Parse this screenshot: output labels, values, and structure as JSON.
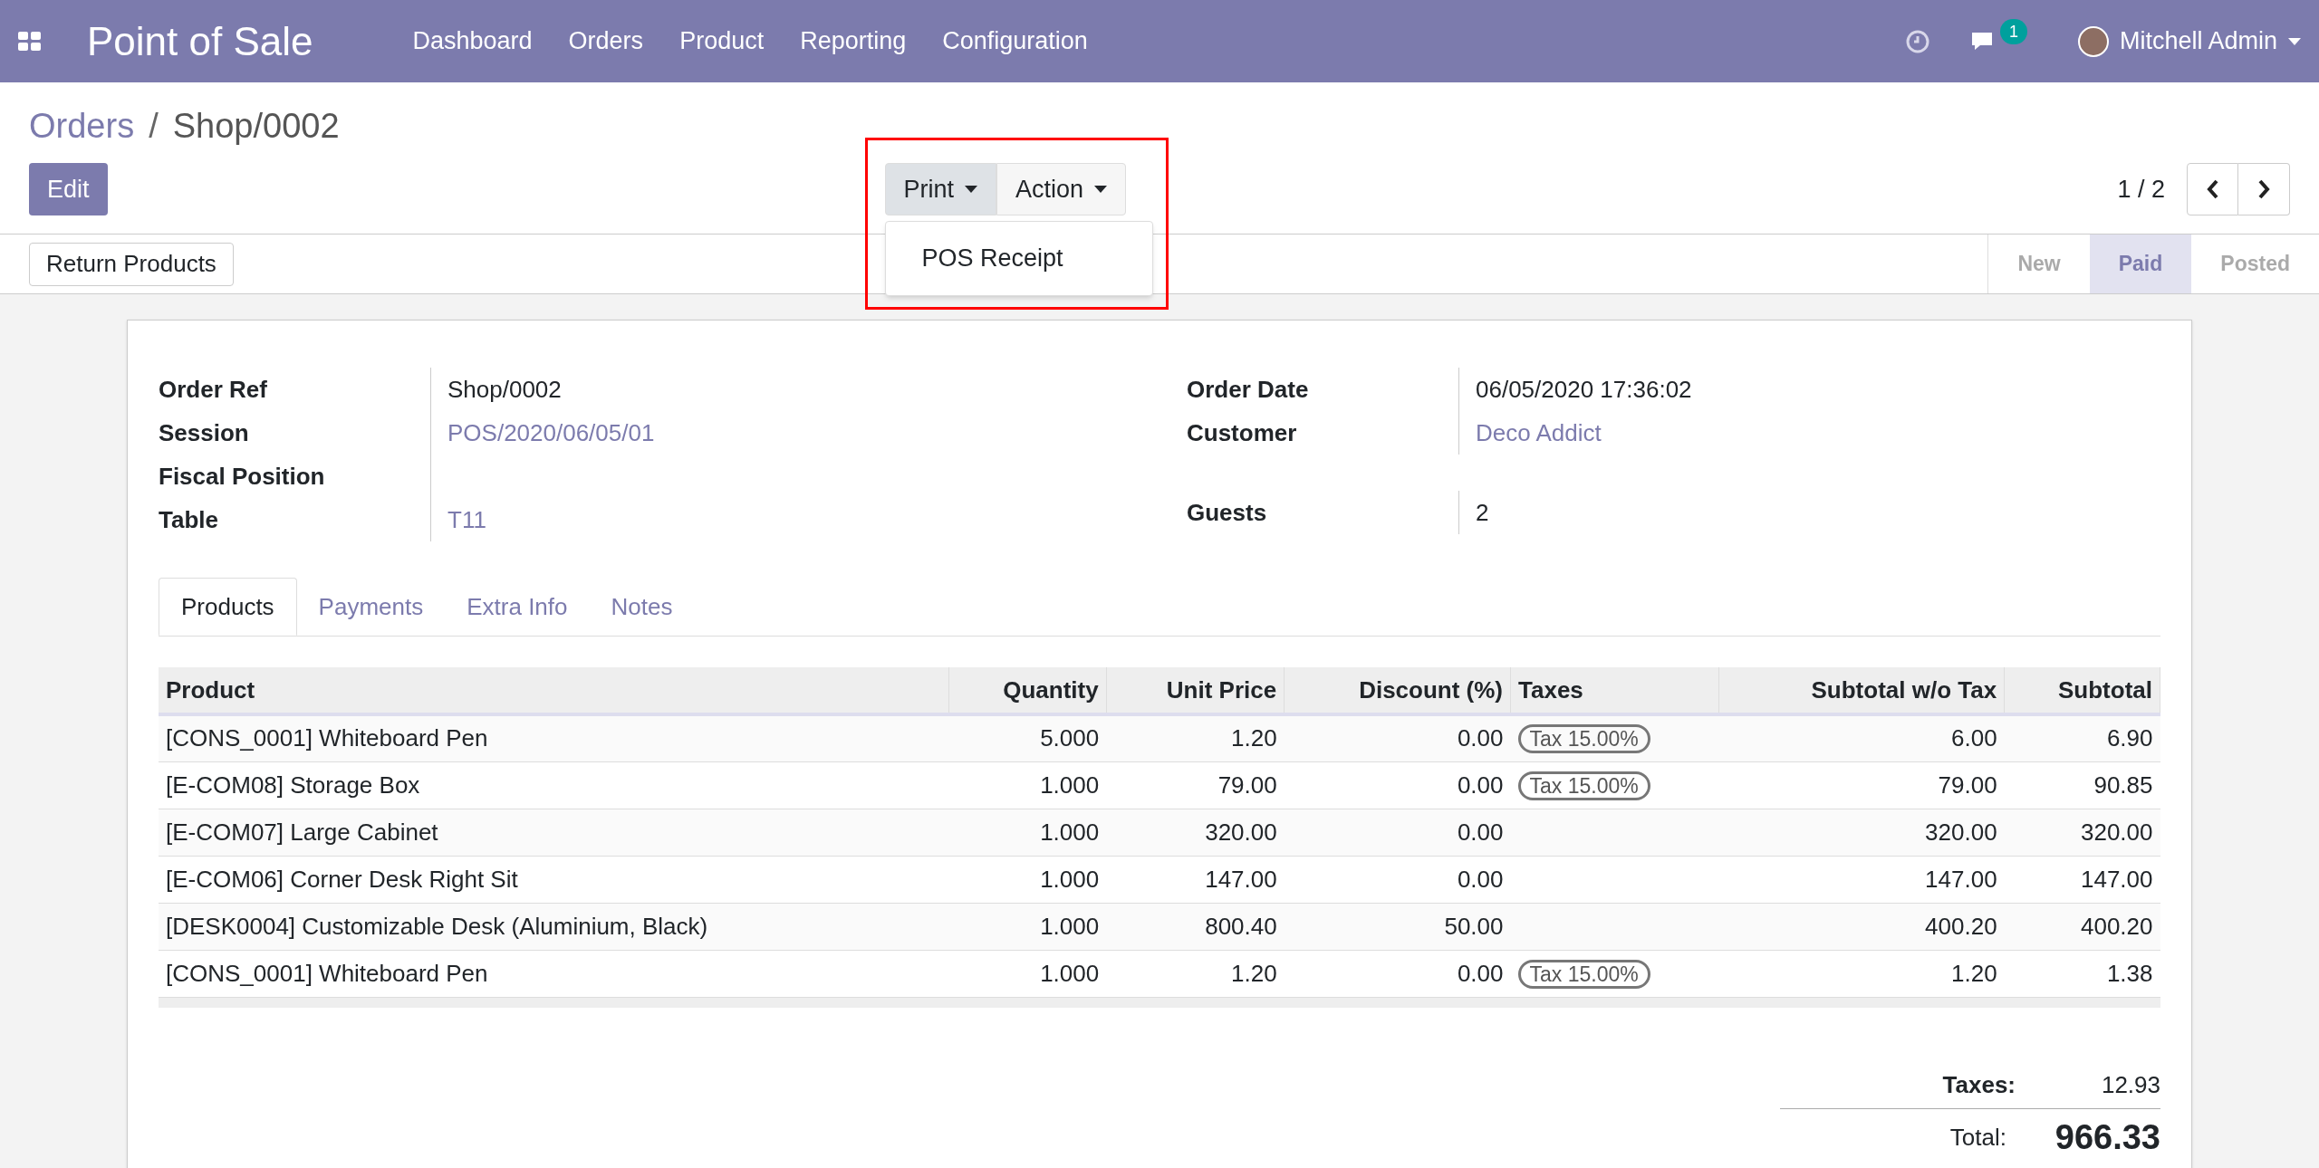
{
  "navbar": {
    "app_title": "Point of Sale",
    "menu": [
      "Dashboard",
      "Orders",
      "Product",
      "Reporting",
      "Configuration"
    ],
    "message_count": "1",
    "user": "Mitchell Admin"
  },
  "breadcrumb": {
    "parent": "Orders",
    "separator": "/",
    "current": "Shop/0002"
  },
  "buttons": {
    "edit": "Edit",
    "print": "Print",
    "action": "Action",
    "return": "Return Products"
  },
  "print_menu": {
    "open": true,
    "items": [
      "POS Receipt"
    ]
  },
  "highlight": true,
  "pager": "1 / 2",
  "status_steps": [
    {
      "label": "New",
      "selected": false
    },
    {
      "label": "Paid",
      "selected": true
    },
    {
      "label": "Posted",
      "selected": false
    }
  ],
  "fields_left": [
    {
      "label": "Order Ref",
      "value": "Shop/0002",
      "link": false
    },
    {
      "label": "Session",
      "value": "POS/2020/06/05/01",
      "link": true
    },
    {
      "label": "Fiscal Position"
    },
    {
      "label": "Table",
      "value": "T11",
      "link": true
    }
  ],
  "fields_right": [
    {
      "label": "Order Date",
      "value": "06/05/2020 17:36:02",
      "link": false
    },
    {
      "label": "Customer",
      "value": "Deco Addict",
      "link": true
    },
    {
      "label": "Guests",
      "value": "2",
      "link": false
    }
  ],
  "tabs": [
    {
      "label": "Products",
      "selected": true
    },
    {
      "label": "Payments",
      "selected": false
    },
    {
      "label": "Extra Info",
      "selected": false
    },
    {
      "label": "Notes",
      "selected": false
    }
  ],
  "table": {
    "columns": [
      "Product",
      "Quantity",
      "Unit Price",
      "Discount (%)",
      "Taxes",
      "Subtotal w/o Tax",
      "Subtotal"
    ],
    "rows": [
      [
        "[CONS_0001] Whiteboard Pen",
        "5.000",
        "1.20",
        "0.00",
        "Tax 15.00%",
        "6.00",
        "6.90"
      ],
      [
        "[E-COM08] Storage Box",
        "1.000",
        "79.00",
        "0.00",
        "Tax 15.00%",
        "79.00",
        "90.85"
      ],
      [
        "[E-COM07] Large Cabinet",
        "1.000",
        "320.00",
        "0.00",
        "",
        "320.00",
        "320.00"
      ],
      [
        "[E-COM06] Corner Desk Right Sit",
        "1.000",
        "147.00",
        "0.00",
        "",
        "147.00",
        "147.00"
      ],
      [
        "[DESK0004] Customizable Desk (Aluminium, Black)",
        "1.000",
        "800.40",
        "50.00",
        "",
        "400.20",
        "400.20"
      ],
      [
        "[CONS_0001] Whiteboard Pen",
        "1.000",
        "1.20",
        "0.00",
        "Tax 15.00%",
        "1.20",
        "1.38"
      ]
    ]
  },
  "totals": {
    "taxes_label": "Taxes:",
    "taxes": "12.93",
    "total_label": "Total:",
    "total": "966.33"
  }
}
